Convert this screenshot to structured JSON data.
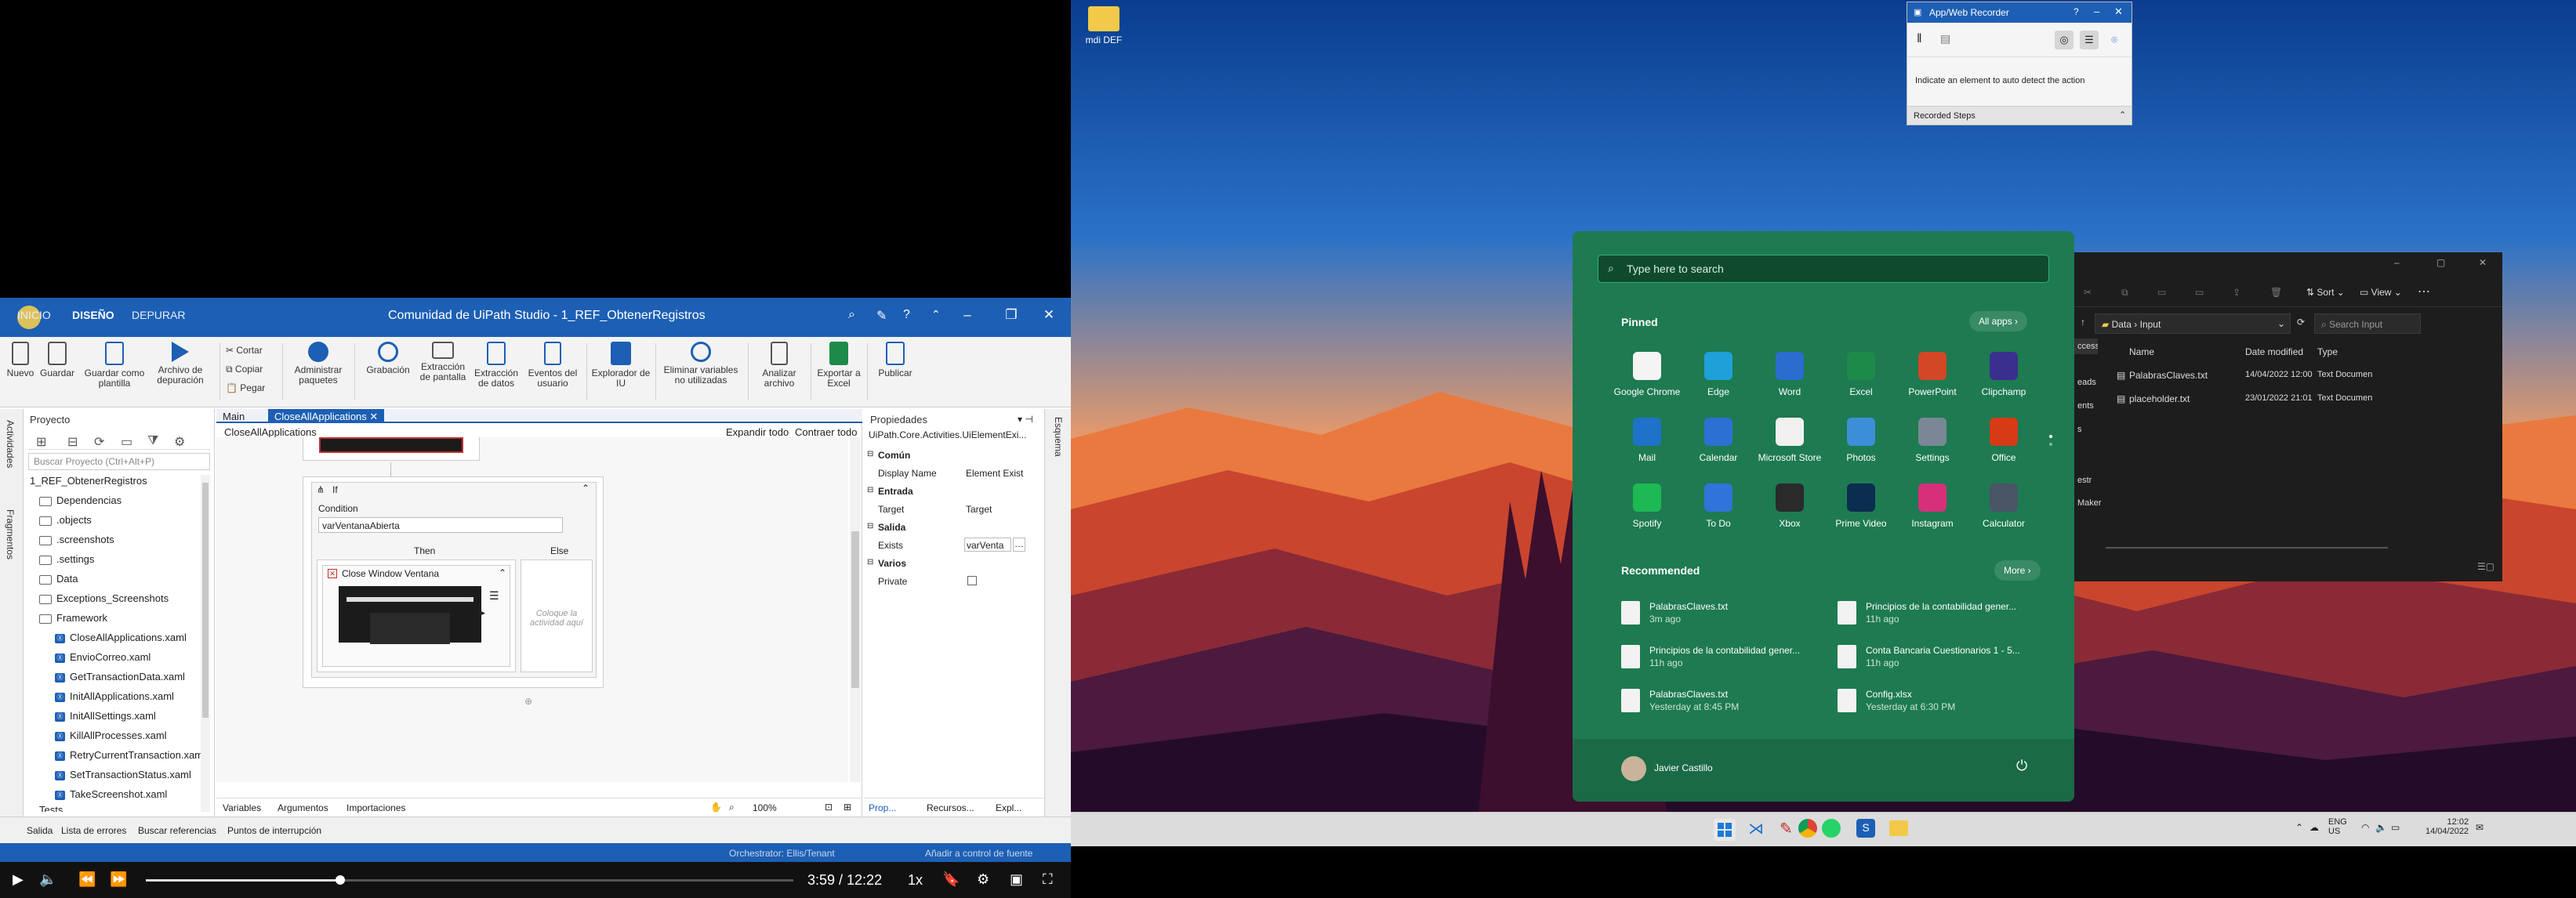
{
  "uipath": {
    "title": "Comunidad de UiPath Studio - 1_REF_ObtenerRegistros",
    "tabs": [
      "INICIO",
      "DISEÑO",
      "DEPURAR"
    ],
    "ribbon": [
      "Nuevo",
      "Guardar",
      "Guardar como plantilla",
      "Archivo de depuración",
      "Cortar",
      "Copiar",
      "Pegar",
      "Administrar paquetes",
      "Grabación",
      "Extracción de pantalla",
      "Extracción de datos",
      "Eventos del usuario",
      "Explorador de IU",
      "Eliminar variables no utilizadas",
      "Analizar archivo",
      "Exportar a Excel",
      "Publicar"
    ],
    "left_vtabs": [
      "Actividades",
      "Fragmentos"
    ],
    "project": {
      "title": "Proyecto",
      "search_placeholder": "Buscar Proyecto (Ctrl+Alt+P)",
      "items": [
        "1_REF_ObtenerRegistros",
        "Dependencias",
        ".objects",
        ".screenshots",
        ".settings",
        "Data",
        "Exceptions_Screenshots",
        "Framework",
        "CloseAllApplications.xaml",
        "EnvioCorreo.xaml",
        "GetTransactionData.xaml",
        "InitAllApplications.xaml",
        "InitAllSettings.xaml",
        "KillAllProcesses.xaml",
        "RetryCurrentTransaction.xaml",
        "SetTransactionStatus.xaml",
        "TakeScreenshot.xaml",
        "Tests"
      ]
    },
    "designer": {
      "tabs": [
        "Main",
        "CloseAllApplications"
      ],
      "breadcrumb": "CloseAllApplications",
      "expand": "Expandir todo",
      "collapse": "Contraer todo",
      "if_label": "If",
      "condition_label": "Condition",
      "condition_value": "varVentanaAbierta",
      "then": "Then",
      "else": "Else",
      "activity": "Close Window Ventana",
      "else_placeholder": "Coloque la actividad aquí",
      "bottom_tabs": [
        "Variables",
        "Argumentos",
        "Importaciones"
      ],
      "zoom": "100%"
    },
    "properties": {
      "title": "Propiedades",
      "type": "UiPath.Core.Activities.UiElementExi...",
      "rows": [
        {
          "k": "Común",
          "v": "",
          "h": true
        },
        {
          "k": "Display Name",
          "v": "Element Exist",
          "h": false
        },
        {
          "k": "Entrada",
          "v": "",
          "h": true
        },
        {
          "k": "Target",
          "v": "Target",
          "h": false
        },
        {
          "k": "Salida",
          "v": "",
          "h": true
        },
        {
          "k": "Exists",
          "v": "varVenta",
          "h": false
        },
        {
          "k": "Varios",
          "v": "",
          "h": true
        },
        {
          "k": "Private",
          "v": "",
          "h": false
        }
      ],
      "bottom_tabs": [
        "Prop...",
        "Recursos...",
        "Expl..."
      ]
    },
    "right_vtab": "Esquema",
    "output_tabs": [
      "Salida",
      "Lista de errores",
      "Buscar referencias",
      "Puntos de interrupción"
    ],
    "status": [
      "Orchestrator: Ellis/Tenant",
      "Añadir a control de fuente"
    ]
  },
  "player": {
    "time": "3:59 / 12:22",
    "speed": "1x",
    "progress": 0.3
  },
  "desktop": {
    "icon_label": "mdi DEF",
    "recorder": {
      "title": "App/Web Recorder",
      "hint": "Indicate an element to auto detect the action",
      "steps": "Recorded Steps"
    },
    "start": {
      "search_placeholder": "Type here to search",
      "pinned": "Pinned",
      "all_apps": "All apps",
      "apps": [
        {
          "name": "Google Chrome",
          "color": "#f4f4f4",
          "icon": "chrome-icon"
        },
        {
          "name": "Edge",
          "color": "#1fa0d8",
          "icon": "edge-icon"
        },
        {
          "name": "Word",
          "color": "#2b6ccf",
          "icon": "word-icon"
        },
        {
          "name": "Excel",
          "color": "#1d8a4a",
          "icon": "excel-icon"
        },
        {
          "name": "PowerPoint",
          "color": "#d24726",
          "icon": "powerpoint-icon"
        },
        {
          "name": "Clipchamp",
          "color": "#3a2f8f",
          "icon": "clipchamp-icon"
        },
        {
          "name": "Mail",
          "color": "#1f72c9",
          "icon": "mail-icon"
        },
        {
          "name": "Calendar",
          "color": "#2b71d4",
          "icon": "calendar-icon"
        },
        {
          "name": "Microsoft Store",
          "color": "#f0f0f0",
          "icon": "store-icon"
        },
        {
          "name": "Photos",
          "color": "#3d8ed8",
          "icon": "photos-icon"
        },
        {
          "name": "Settings",
          "color": "#7a8796",
          "icon": "settings-icon"
        },
        {
          "name": "Office",
          "color": "#d63b16",
          "icon": "office-icon"
        },
        {
          "name": "Spotify",
          "color": "#1db954",
          "icon": "spotify-icon"
        },
        {
          "name": "To Do",
          "color": "#2e74d9",
          "icon": "todo-icon"
        },
        {
          "name": "Xbox",
          "color": "#2a2a2a",
          "icon": "xbox-icon"
        },
        {
          "name": "Prime Video",
          "color": "#0b2d50",
          "icon": "prime-video-icon"
        },
        {
          "name": "Instagram",
          "color": "#d6307b",
          "icon": "instagram-icon"
        },
        {
          "name": "Calculator",
          "color": "#4a5566",
          "icon": "calculator-icon"
        }
      ],
      "recommended": "Recommended",
      "more": "More",
      "recs": [
        {
          "name": "PalabrasClaves.txt",
          "time": "3m ago"
        },
        {
          "name": "Principios de la contabilidad gener...",
          "time": "11h ago"
        },
        {
          "name": "Principios de la contabilidad gener...",
          "time": "11h ago"
        },
        {
          "name": "Conta Bancaria Cuestionarios 1 - 5...",
          "time": "11h ago"
        },
        {
          "name": "PalabrasClaves.txt",
          "time": "Yesterday at 8:45 PM"
        },
        {
          "name": "Config.xlsx",
          "time": "Yesterday at 6:30 PM"
        }
      ],
      "user": "Javier Castillo"
    },
    "explorer": {
      "path_root": "Data",
      "path_leaf": "Input",
      "search": "Search Input",
      "sort": "Sort",
      "view": "View",
      "cols": [
        "Name",
        "Date modified",
        "Type"
      ],
      "rows": [
        {
          "name": "PalabrasClaves.txt",
          "date": "14/04/2022 12:00",
          "type": "Text Documen"
        },
        {
          "name": "placeholder.txt",
          "date": "23/01/2022 21:01",
          "type": "Text Documen"
        }
      ],
      "side": [
        "ccess",
        "eads",
        "ents",
        "s",
        "",
        "estr",
        "Maker"
      ]
    },
    "tray": {
      "lang1": "ENG",
      "lang2": "US",
      "time": "12:02",
      "date": "14/04/2022"
    }
  }
}
